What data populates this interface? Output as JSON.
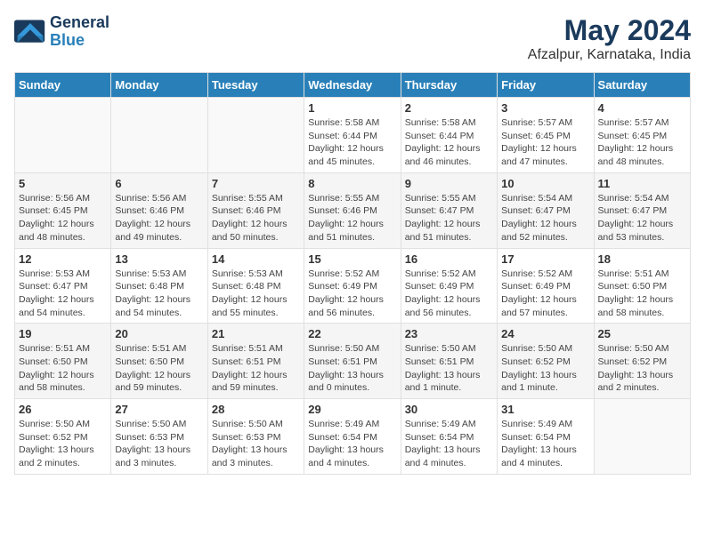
{
  "logo": {
    "line1": "General",
    "line2": "Blue"
  },
  "title": "May 2024",
  "subtitle": "Afzalpur, Karnataka, India",
  "headers": [
    "Sunday",
    "Monday",
    "Tuesday",
    "Wednesday",
    "Thursday",
    "Friday",
    "Saturday"
  ],
  "weeks": [
    [
      {
        "day": "",
        "info": ""
      },
      {
        "day": "",
        "info": ""
      },
      {
        "day": "",
        "info": ""
      },
      {
        "day": "1",
        "info": "Sunrise: 5:58 AM\nSunset: 6:44 PM\nDaylight: 12 hours\nand 45 minutes."
      },
      {
        "day": "2",
        "info": "Sunrise: 5:58 AM\nSunset: 6:44 PM\nDaylight: 12 hours\nand 46 minutes."
      },
      {
        "day": "3",
        "info": "Sunrise: 5:57 AM\nSunset: 6:45 PM\nDaylight: 12 hours\nand 47 minutes."
      },
      {
        "day": "4",
        "info": "Sunrise: 5:57 AM\nSunset: 6:45 PM\nDaylight: 12 hours\nand 48 minutes."
      }
    ],
    [
      {
        "day": "5",
        "info": "Sunrise: 5:56 AM\nSunset: 6:45 PM\nDaylight: 12 hours\nand 48 minutes."
      },
      {
        "day": "6",
        "info": "Sunrise: 5:56 AM\nSunset: 6:46 PM\nDaylight: 12 hours\nand 49 minutes."
      },
      {
        "day": "7",
        "info": "Sunrise: 5:55 AM\nSunset: 6:46 PM\nDaylight: 12 hours\nand 50 minutes."
      },
      {
        "day": "8",
        "info": "Sunrise: 5:55 AM\nSunset: 6:46 PM\nDaylight: 12 hours\nand 51 minutes."
      },
      {
        "day": "9",
        "info": "Sunrise: 5:55 AM\nSunset: 6:47 PM\nDaylight: 12 hours\nand 51 minutes."
      },
      {
        "day": "10",
        "info": "Sunrise: 5:54 AM\nSunset: 6:47 PM\nDaylight: 12 hours\nand 52 minutes."
      },
      {
        "day": "11",
        "info": "Sunrise: 5:54 AM\nSunset: 6:47 PM\nDaylight: 12 hours\nand 53 minutes."
      }
    ],
    [
      {
        "day": "12",
        "info": "Sunrise: 5:53 AM\nSunset: 6:47 PM\nDaylight: 12 hours\nand 54 minutes."
      },
      {
        "day": "13",
        "info": "Sunrise: 5:53 AM\nSunset: 6:48 PM\nDaylight: 12 hours\nand 54 minutes."
      },
      {
        "day": "14",
        "info": "Sunrise: 5:53 AM\nSunset: 6:48 PM\nDaylight: 12 hours\nand 55 minutes."
      },
      {
        "day": "15",
        "info": "Sunrise: 5:52 AM\nSunset: 6:49 PM\nDaylight: 12 hours\nand 56 minutes."
      },
      {
        "day": "16",
        "info": "Sunrise: 5:52 AM\nSunset: 6:49 PM\nDaylight: 12 hours\nand 56 minutes."
      },
      {
        "day": "17",
        "info": "Sunrise: 5:52 AM\nSunset: 6:49 PM\nDaylight: 12 hours\nand 57 minutes."
      },
      {
        "day": "18",
        "info": "Sunrise: 5:51 AM\nSunset: 6:50 PM\nDaylight: 12 hours\nand 58 minutes."
      }
    ],
    [
      {
        "day": "19",
        "info": "Sunrise: 5:51 AM\nSunset: 6:50 PM\nDaylight: 12 hours\nand 58 minutes."
      },
      {
        "day": "20",
        "info": "Sunrise: 5:51 AM\nSunset: 6:50 PM\nDaylight: 12 hours\nand 59 minutes."
      },
      {
        "day": "21",
        "info": "Sunrise: 5:51 AM\nSunset: 6:51 PM\nDaylight: 12 hours\nand 59 minutes."
      },
      {
        "day": "22",
        "info": "Sunrise: 5:50 AM\nSunset: 6:51 PM\nDaylight: 13 hours\nand 0 minutes."
      },
      {
        "day": "23",
        "info": "Sunrise: 5:50 AM\nSunset: 6:51 PM\nDaylight: 13 hours\nand 1 minute."
      },
      {
        "day": "24",
        "info": "Sunrise: 5:50 AM\nSunset: 6:52 PM\nDaylight: 13 hours\nand 1 minute."
      },
      {
        "day": "25",
        "info": "Sunrise: 5:50 AM\nSunset: 6:52 PM\nDaylight: 13 hours\nand 2 minutes."
      }
    ],
    [
      {
        "day": "26",
        "info": "Sunrise: 5:50 AM\nSunset: 6:52 PM\nDaylight: 13 hours\nand 2 minutes."
      },
      {
        "day": "27",
        "info": "Sunrise: 5:50 AM\nSunset: 6:53 PM\nDaylight: 13 hours\nand 3 minutes."
      },
      {
        "day": "28",
        "info": "Sunrise: 5:50 AM\nSunset: 6:53 PM\nDaylight: 13 hours\nand 3 minutes."
      },
      {
        "day": "29",
        "info": "Sunrise: 5:49 AM\nSunset: 6:54 PM\nDaylight: 13 hours\nand 4 minutes."
      },
      {
        "day": "30",
        "info": "Sunrise: 5:49 AM\nSunset: 6:54 PM\nDaylight: 13 hours\nand 4 minutes."
      },
      {
        "day": "31",
        "info": "Sunrise: 5:49 AM\nSunset: 6:54 PM\nDaylight: 13 hours\nand 4 minutes."
      },
      {
        "day": "",
        "info": ""
      }
    ]
  ]
}
